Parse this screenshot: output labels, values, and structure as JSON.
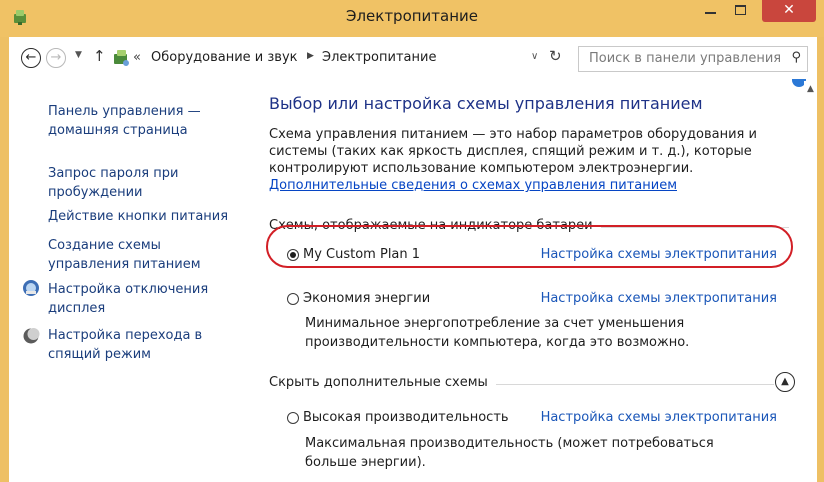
{
  "window": {
    "title": "Электропитание",
    "controls": {
      "minimize": "minimize",
      "maximize": "maximize",
      "close": "close"
    }
  },
  "addressbar": {
    "breadcrumb": [
      "«",
      "Оборудование и звук",
      "▶",
      "Электропитание"
    ],
    "search_placeholder": "Поиск в панели управления"
  },
  "sidebar": {
    "items": [
      {
        "label": "Панель управления — домашняя страница",
        "icon": null
      },
      {
        "label": "Запрос пароля при пробуждении",
        "icon": null
      },
      {
        "label": "Действие кнопки питания",
        "icon": null
      },
      {
        "label": "Создание схемы управления питанием",
        "icon": null
      },
      {
        "label": "Настройка отключения дисплея",
        "icon": "display-icon"
      },
      {
        "label": "Настройка перехода в спящий режим",
        "icon": "moon-icon"
      }
    ]
  },
  "main": {
    "heading": "Выбор или настройка схемы управления питанием",
    "description": "Схема управления питанием — это набор параметров оборудования и системы (таких как яркость дисплея, спящий режим и т. д.), которые контролируют использование компьютером электроэнергии.",
    "more_link": "Дополнительные сведения о схемах управления питанием",
    "section_battery": "Схемы, отображаемые на индикаторе батареи",
    "section_hidden": "Скрыть дополнительные схемы",
    "plans": [
      {
        "name": "My Custom Plan 1",
        "link": "Настройка схемы электропитания",
        "selected": true,
        "description": ""
      },
      {
        "name": "Экономия энергии",
        "link": "Настройка схемы электропитания",
        "selected": false,
        "description": "Минимальное энергопотребление за счет уменьшения производительности компьютера, когда это возможно."
      },
      {
        "name": "Высокая производительность",
        "link": "Настройка схемы электропитания",
        "selected": false,
        "description": "Максимальная производительность (может потребоваться больше энергии)."
      }
    ]
  },
  "colors": {
    "titlebar": "#f0c265",
    "close_button": "#c9463d",
    "heading": "#1e3287",
    "link": "#1a56b8",
    "highlight": "#d21f26"
  }
}
